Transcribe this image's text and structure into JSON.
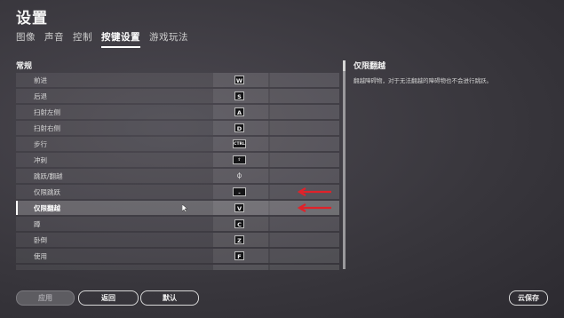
{
  "header": {
    "title": "设置"
  },
  "tabs": [
    {
      "label": "图像",
      "active": false
    },
    {
      "label": "声音",
      "active": false
    },
    {
      "label": "控制",
      "active": false
    },
    {
      "label": "按键设置",
      "active": true
    },
    {
      "label": "游戏玩法",
      "active": false
    }
  ],
  "section": {
    "title": "常规"
  },
  "bindings": [
    {
      "action": "前进",
      "key": "W"
    },
    {
      "action": "后退",
      "key": "S"
    },
    {
      "action": "扫射左侧",
      "key": "A"
    },
    {
      "action": "扫射右侧",
      "key": "D"
    },
    {
      "action": "步行",
      "key": "CTRL"
    },
    {
      "action": "冲刺",
      "key": "⇧"
    },
    {
      "action": "跳跃/翻越",
      "key": "⏀"
    },
    {
      "action": "仅限跳跃",
      "key": "⎵"
    },
    {
      "action": "仅限翻越",
      "key": "V",
      "selected": true
    },
    {
      "action": "蹲",
      "key": "C"
    },
    {
      "action": "卧倒",
      "key": "Z"
    },
    {
      "action": "使用",
      "key": "F"
    },
    {
      "action": "",
      "key": ""
    }
  ],
  "detail": {
    "title": "仅限翻越",
    "description": "翻越障碍物，对于无法翻越的障碍物也不会进行跳跃。"
  },
  "footer": {
    "apply": "应用",
    "back": "返回",
    "default": "默认",
    "cloud_save": "云保存"
  },
  "colors": {
    "annotation_arrow": "#e0222a",
    "selected_indicator": "#ffffff"
  },
  "icons": {
    "cursor": "mouse-pointer-icon",
    "annotation": "red-arrow-annotation"
  }
}
